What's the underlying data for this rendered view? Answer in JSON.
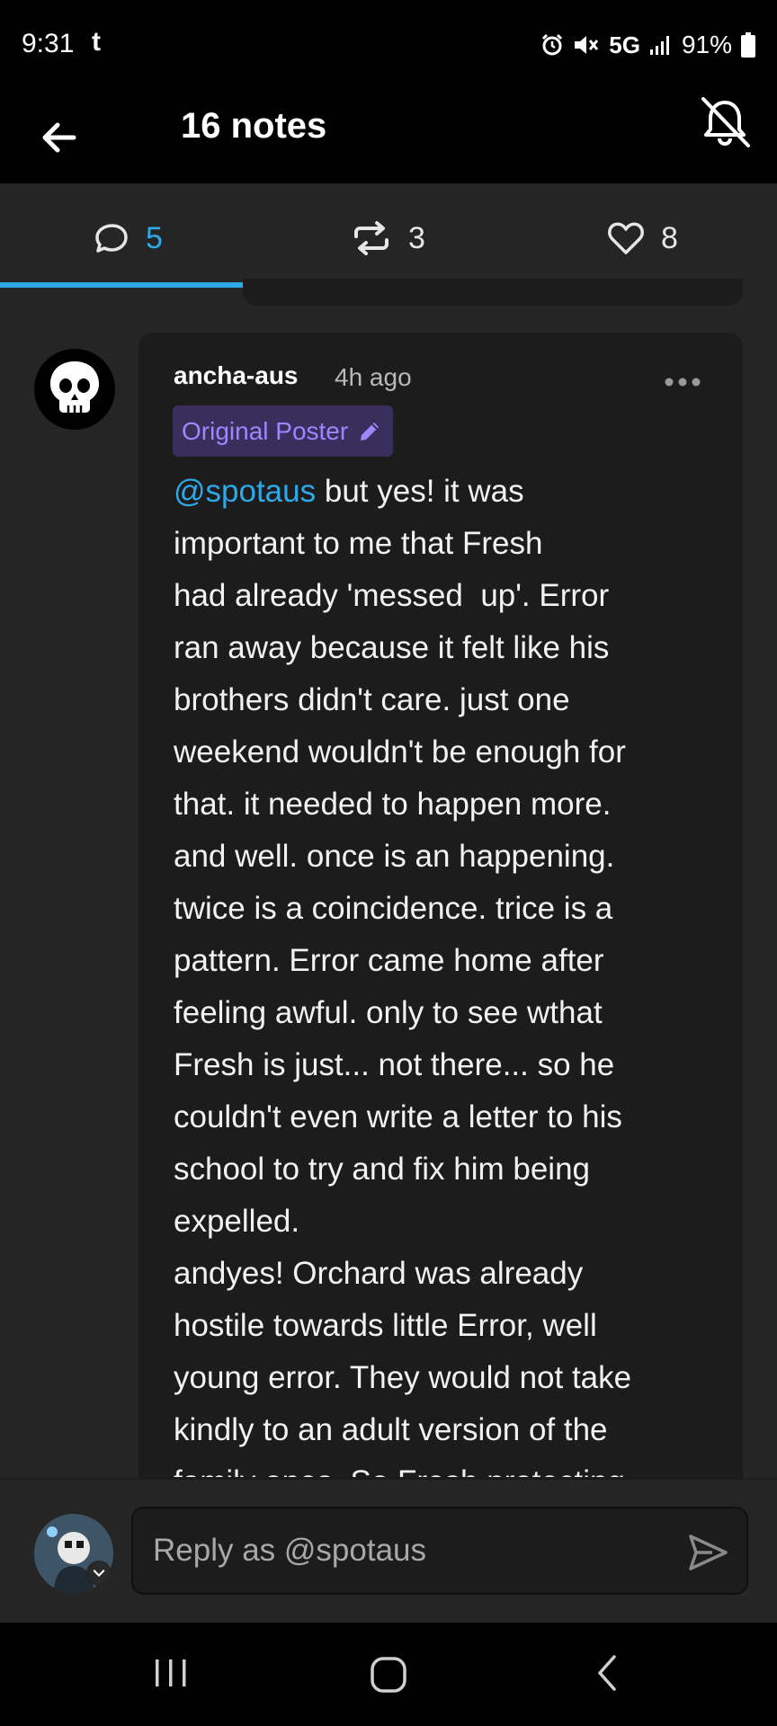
{
  "status_bar": {
    "time": "9:31",
    "app_indicator": "t",
    "network": "5G",
    "battery": "91%",
    "icons": [
      "alarm-icon",
      "mute-icon",
      "signal-icon",
      "battery-icon"
    ]
  },
  "header": {
    "title": "16 notes",
    "back_icon": "arrow-left-icon",
    "notifications_icon": "bell-off-icon"
  },
  "tabs": [
    {
      "icon": "comment-icon",
      "count": "5",
      "active": true
    },
    {
      "icon": "reblog-icon",
      "count": "3",
      "active": false
    },
    {
      "icon": "heart-icon",
      "count": "8",
      "active": false
    }
  ],
  "post": {
    "author": "ancha-aus",
    "time": "4h ago",
    "badge": "Original Poster",
    "mention": "@spotaus",
    "body": " but yes! it was\nimportant to me that Fresh\nhad already 'messed  up'. Error\nran away because it felt like his\nbrothers didn't care. just one\nweekend wouldn't be enough for\nthat. it needed to happen more.\nand well. once is an happening.\ntwice is a coincidence. trice is a\npattern. Error came home after\nfeeling awful. only to see wthat\nFresh is just... not there... so he\ncouldn't even write a letter to his\nschool to try and fix him being\nexpelled.\nandyes! Orchard was already\nhostile towards little Error, well\nyoung error. They would not take\nkindly to an adult version of the\nfamily ones. So Fresh protecting"
  },
  "reply": {
    "placeholder": "Reply as @spotaus"
  },
  "colors": {
    "accent": "#2fa8e8",
    "badge_bg": "#3a2e5c",
    "badge_text": "#9d86ff",
    "background": "#252525",
    "card": "#1c1c1c"
  }
}
